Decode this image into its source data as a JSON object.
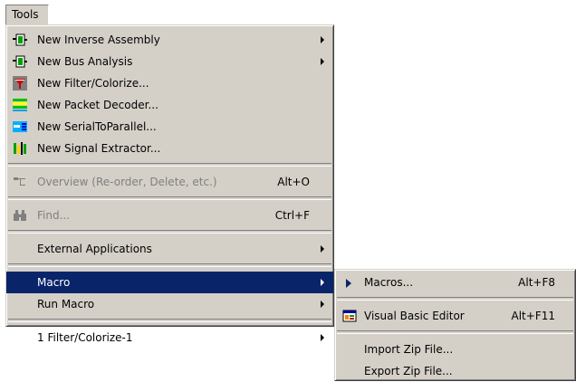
{
  "menubar": {
    "tools": "Tools"
  },
  "tools_menu": {
    "inverse_assembly": "New Inverse Assembly",
    "bus_analysis": "New Bus Analysis",
    "filter_colorize": "New Filter/Colorize...",
    "packet_decoder": "New Packet Decoder...",
    "serial_to_parallel": "New SerialToParallel...",
    "signal_extractor": "New Signal Extractor...",
    "overview": "Overview (Re-order, Delete, etc.)",
    "overview_shortcut": "Alt+O",
    "find": "Find...",
    "find_shortcut": "Ctrl+F",
    "external_apps": "External Applications",
    "macro": "Macro",
    "run_macro": "Run Macro",
    "recent_filter": "1 Filter/Colorize-1"
  },
  "macro_submenu": {
    "macros": "Macros...",
    "macros_shortcut": "Alt+F8",
    "vb_editor": "Visual Basic Editor",
    "vb_editor_shortcut": "Alt+F11",
    "import_zip": "Import Zip File...",
    "export_zip": "Export Zip File..."
  },
  "icons": {
    "inverse_assembly": "module-icon",
    "bus_analysis": "module-icon",
    "filter_colorize": "filter-colorize-icon",
    "packet_decoder": "packet-decoder-icon",
    "serial_to_parallel": "serial-to-parallel-icon",
    "signal_extractor": "signal-extractor-icon",
    "overview": "overview-icon",
    "find": "binoculars-icon",
    "vb_editor": "vb-editor-icon",
    "macros": "play-triangle-icon"
  },
  "colors": {
    "menu_bg": "#d4d0c8",
    "selection": "#0a246a",
    "disabled": "#808080"
  }
}
